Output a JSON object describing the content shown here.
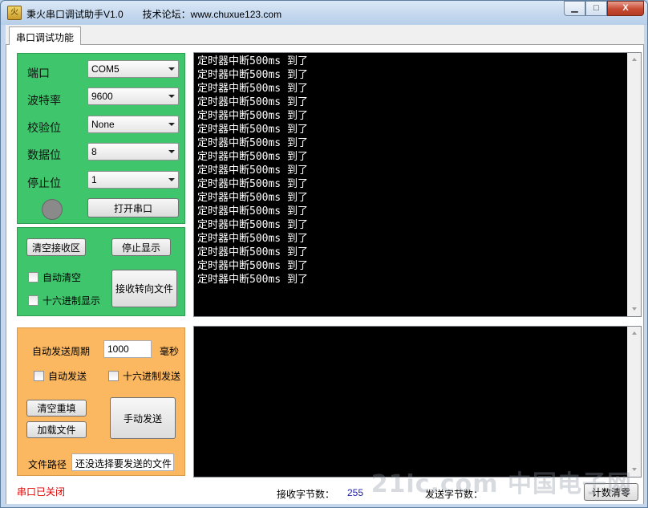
{
  "window": {
    "title": "秉火串口调试助手V1.0　　技术论坛：www.chuxue123.com",
    "icon_text": "火",
    "min_label": "▁",
    "max_label": "□",
    "close_label": "X"
  },
  "tab": {
    "label": "串口调试功能"
  },
  "serial_settings": {
    "port_label": "端口",
    "port_value": "COM5",
    "baud_label": "波特率",
    "baud_value": "9600",
    "parity_label": "校验位",
    "parity_value": "None",
    "databits_label": "数据位",
    "databits_value": "8",
    "stopbits_label": "停止位",
    "stopbits_value": "1",
    "open_port_label": "打开串口",
    "led_color": "#8a8a8a"
  },
  "receive_controls": {
    "clear_label": "清空接收区",
    "stop_display_label": "停止显示",
    "auto_clear_label": "自动清空",
    "hex_display_label": "十六进制显示",
    "redirect_file_label": "接收转向文件"
  },
  "send_controls": {
    "period_label": "自动发送周期",
    "period_value": "1000",
    "period_unit": "毫秒",
    "auto_send_label": "自动发送",
    "hex_send_label": "十六进制发送",
    "clear_refill_label": "清空重填",
    "load_file_label": "加载文件",
    "manual_send_label": "手动发送",
    "file_path_label": "文件路径",
    "file_path_value": "还没选择要发送的文件"
  },
  "receive_area": {
    "lines": [
      "定时器中断500ms 到了",
      "定时器中断500ms 到了",
      "定时器中断500ms 到了",
      "定时器中断500ms 到了",
      "定时器中断500ms 到了",
      "定时器中断500ms 到了",
      "定时器中断500ms 到了",
      "定时器中断500ms 到了",
      "定时器中断500ms 到了",
      "定时器中断500ms 到了",
      "定时器中断500ms 到了",
      "定时器中断500ms 到了",
      "定时器中断500ms 到了",
      "定时器中断500ms 到了",
      "定时器中断500ms 到了",
      "定时器中断500ms 到了",
      "定时器中断500ms 到了"
    ]
  },
  "status_bar": {
    "port_status": "串口已关闭",
    "port_status_color": "#e00000",
    "rx_label": "接收字节数：",
    "rx_value": "255",
    "tx_label": "发送字节数：",
    "clear_count_label": "计数清零"
  },
  "watermark": "21ic.com 中国电子网",
  "colors": {
    "green_panel": "#3fc66c",
    "orange_panel": "#fcb860",
    "terminal_bg": "#000000"
  }
}
